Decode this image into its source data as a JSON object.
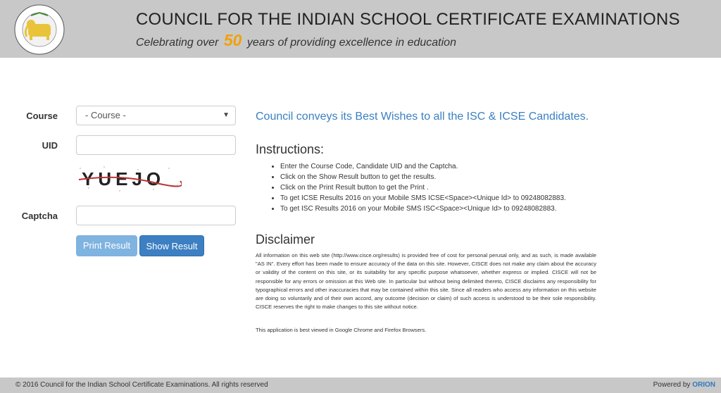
{
  "header": {
    "logo_text": "COUNCIL FOR THE INDIAN SCHOOL CERTIFICATE EXAMINATIONS · NEW DELHI",
    "logo_bottom": "NEW DELHI",
    "title": "COUNCIL FOR THE INDIAN SCHOOL CERTIFICATE EXAMINATIONS",
    "tagline_pre": "Celebrating over",
    "tagline_num": "50",
    "tagline_post": "years of providing excellence in education"
  },
  "form": {
    "course_label": "Course",
    "course_value": "- Course -",
    "uid_label": "UID",
    "uid_value": "",
    "captcha_text": "YUEJO",
    "captcha_label": "Captcha",
    "captcha_value": "",
    "print_label": "Print Result",
    "show_label": "Show Result"
  },
  "content": {
    "wishes": "Council conveys its Best Wishes to all the ISC & ICSE Candidates.",
    "instructions_title": "Instructions:",
    "instructions": [
      "Enter the Course Code, Candidate UID and the Captcha.",
      "Click on the Show Result button to get the results.",
      "Click on the Print Result button to get the Print .",
      "To get ICSE Results 2016 on your Mobile SMS ICSE<Space><Unique Id> to 09248082883.",
      "To get ISC Results 2016 on your Mobile SMS ISC<Space><Unique Id> to 09248082883."
    ],
    "disclaimer_title": "Disclaimer",
    "disclaimer_text": "All information on this web site (http://www.cisce.org/results) is provided free of cost for personal perusal only, and as such, is made available \"AS IN\". Every effort has been made to ensure accuracy of the data on this site. However, CISCE does not make any claim about the accuracy or validity of the content on this site, or its suitability for any specific purpose whatsoever, whether express or implied. CISCE will not be responsible for any errors or omission at this Web site. In particular but without being delimited thereto, CISCE disclaims any responsibility for typographical errors and other inaccuracies that may be contained within this site. Since all readers who access any information on this website are doing so voluntarily and of their own accord, any outcome (decision or claim) of such access is understood to be their sole responsibility. CISCE reserves the right to make changes to this site without notice.",
    "browser_note": "This application is best viewed in Google Chrome and Firefox Browsers."
  },
  "footer": {
    "copyright": "© 2016 Council for the Indian School Certificate Examinations. All rights reserved",
    "powered_pre": "Powered by",
    "powered_brand": "ORION"
  },
  "colors": {
    "header_bg": "#c8c8c8",
    "accent_blue": "#3a80c2",
    "tagline_number": "#f0a20a",
    "print_btn": "#7fb3e0",
    "show_btn": "#3c7fc2"
  }
}
